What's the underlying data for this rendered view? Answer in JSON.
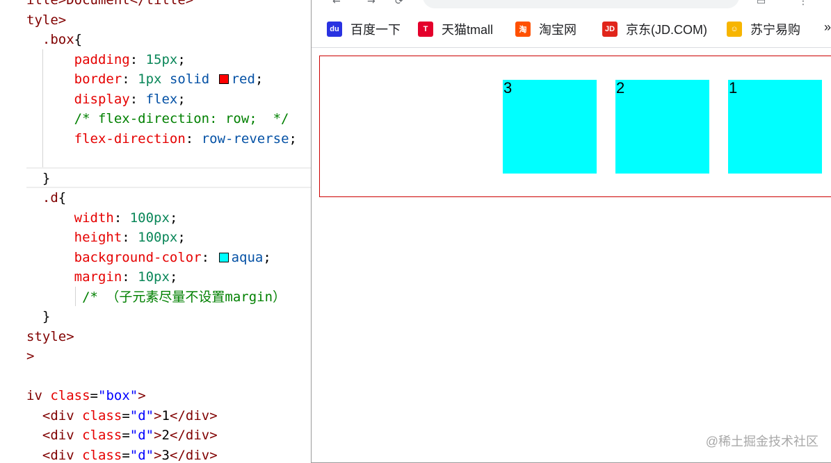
{
  "editor": {
    "lines": [
      {
        "segments": [
          {
            "t": "itle>Document</title>",
            "c": "tag"
          }
        ]
      },
      {
        "segments": [
          {
            "t": "tyle>",
            "c": "tag"
          }
        ]
      },
      {
        "segments": [
          {
            "t": "  ",
            "c": "txt"
          },
          {
            "t": ".box",
            "c": "sel"
          },
          {
            "t": "{",
            "c": "txt"
          }
        ]
      },
      {
        "segments": [
          {
            "t": "      ",
            "c": "txt"
          },
          {
            "t": "padding",
            "c": "prop"
          },
          {
            "t": ": ",
            "c": "txt"
          },
          {
            "t": "15px",
            "c": "num"
          },
          {
            "t": ";",
            "c": "txt"
          }
        ]
      },
      {
        "segments": [
          {
            "t": "      ",
            "c": "txt"
          },
          {
            "t": "border",
            "c": "prop"
          },
          {
            "t": ": ",
            "c": "txt"
          },
          {
            "t": "1px",
            "c": "num"
          },
          {
            "t": " ",
            "c": "txt"
          },
          {
            "t": "solid",
            "c": "val"
          },
          {
            "t": " ",
            "c": "txt"
          },
          {
            "swatch": "#ff0000"
          },
          {
            "t": "red",
            "c": "val"
          },
          {
            "t": ";",
            "c": "txt"
          }
        ]
      },
      {
        "segments": [
          {
            "t": "      ",
            "c": "txt"
          },
          {
            "t": "display",
            "c": "prop"
          },
          {
            "t": ": ",
            "c": "txt"
          },
          {
            "t": "flex",
            "c": "val"
          },
          {
            "t": ";",
            "c": "txt"
          }
        ]
      },
      {
        "segments": [
          {
            "t": "      ",
            "c": "txt"
          },
          {
            "t": "/* flex-direction: row;  */",
            "c": "cmt"
          }
        ]
      },
      {
        "segments": [
          {
            "t": "      ",
            "c": "txt"
          },
          {
            "t": "flex-direction",
            "c": "prop"
          },
          {
            "t": ": ",
            "c": "txt"
          },
          {
            "t": "row-reverse",
            "c": "val"
          },
          {
            "t": ";",
            "c": "txt"
          }
        ]
      },
      {
        "segments": [
          {
            "t": "",
            "c": "txt"
          }
        ]
      },
      {
        "segments": [
          {
            "t": "  }",
            "c": "txt"
          }
        ]
      },
      {
        "segments": [
          {
            "t": "  ",
            "c": "txt"
          },
          {
            "t": ".d",
            "c": "sel"
          },
          {
            "t": "{",
            "c": "txt"
          }
        ]
      },
      {
        "segments": [
          {
            "t": "      ",
            "c": "txt"
          },
          {
            "t": "width",
            "c": "prop"
          },
          {
            "t": ": ",
            "c": "txt"
          },
          {
            "t": "100px",
            "c": "num"
          },
          {
            "t": ";",
            "c": "txt"
          }
        ]
      },
      {
        "segments": [
          {
            "t": "      ",
            "c": "txt"
          },
          {
            "t": "height",
            "c": "prop"
          },
          {
            "t": ": ",
            "c": "txt"
          },
          {
            "t": "100px",
            "c": "num"
          },
          {
            "t": ";",
            "c": "txt"
          }
        ]
      },
      {
        "segments": [
          {
            "t": "      ",
            "c": "txt"
          },
          {
            "t": "background-color",
            "c": "prop"
          },
          {
            "t": ": ",
            "c": "txt"
          },
          {
            "swatch": "#00ffff"
          },
          {
            "t": "aqua",
            "c": "val"
          },
          {
            "t": ";",
            "c": "txt"
          }
        ]
      },
      {
        "segments": [
          {
            "t": "      ",
            "c": "txt"
          },
          {
            "t": "margin",
            "c": "prop"
          },
          {
            "t": ": ",
            "c": "txt"
          },
          {
            "t": "10px",
            "c": "num"
          },
          {
            "t": ";",
            "c": "txt"
          }
        ]
      },
      {
        "segments": [
          {
            "t": "       ",
            "c": "txt"
          },
          {
            "t": "/* （子元素尽量不设置margin）",
            "c": "cmt"
          }
        ]
      },
      {
        "segments": [
          {
            "t": "  }",
            "c": "txt"
          }
        ]
      },
      {
        "segments": [
          {
            "t": "style>",
            "c": "tag"
          }
        ]
      },
      {
        "segments": [
          {
            "t": ">",
            "c": "tag"
          }
        ]
      },
      {
        "segments": [
          {
            "t": "",
            "c": "txt"
          }
        ]
      },
      {
        "segments": [
          {
            "t": "iv",
            "c": "tag"
          },
          {
            "t": " ",
            "c": "txt"
          },
          {
            "t": "class",
            "c": "attr"
          },
          {
            "t": "=",
            "c": "txt"
          },
          {
            "t": "\"box\"",
            "c": "str"
          },
          {
            "t": ">",
            "c": "tag"
          }
        ]
      },
      {
        "segments": [
          {
            "t": "  ",
            "c": "txt"
          },
          {
            "t": "<div",
            "c": "tag"
          },
          {
            "t": " ",
            "c": "txt"
          },
          {
            "t": "class",
            "c": "attr"
          },
          {
            "t": "=",
            "c": "txt"
          },
          {
            "t": "\"d\"",
            "c": "str"
          },
          {
            "t": ">",
            "c": "tag"
          },
          {
            "t": "1",
            "c": "txt"
          },
          {
            "t": "</div>",
            "c": "tag"
          }
        ]
      },
      {
        "segments": [
          {
            "t": "  ",
            "c": "txt"
          },
          {
            "t": "<div",
            "c": "tag"
          },
          {
            "t": " ",
            "c": "txt"
          },
          {
            "t": "class",
            "c": "attr"
          },
          {
            "t": "=",
            "c": "txt"
          },
          {
            "t": "\"d\"",
            "c": "str"
          },
          {
            "t": ">",
            "c": "tag"
          },
          {
            "t": "2",
            "c": "txt"
          },
          {
            "t": "</div>",
            "c": "tag"
          }
        ]
      },
      {
        "segments": [
          {
            "t": "  ",
            "c": "txt"
          },
          {
            "t": "<div",
            "c": "tag"
          },
          {
            "t": " ",
            "c": "txt"
          },
          {
            "t": "class",
            "c": "attr"
          },
          {
            "t": "=",
            "c": "txt"
          },
          {
            "t": "\"d\"",
            "c": "str"
          },
          {
            "t": ">",
            "c": "tag"
          },
          {
            "t": "3",
            "c": "txt"
          },
          {
            "t": "</div>",
            "c": "tag"
          }
        ]
      }
    ]
  },
  "browser": {
    "bookmarks": [
      {
        "label": "百度一下",
        "icon": "baidu-icon",
        "glyph": "du",
        "color": "#2932e1"
      },
      {
        "label": "天猫tmall",
        "icon": "tmall-icon",
        "glyph": "T",
        "color": "#e4002b"
      },
      {
        "label": "淘宝网",
        "icon": "taobao-icon",
        "glyph": "淘",
        "color": "#ff5000"
      },
      {
        "label": "京东(JD.COM)",
        "icon": "jd-icon",
        "glyph": "JD",
        "color": "#e1251b"
      },
      {
        "label": "苏宁易购",
        "icon": "suning-icon",
        "glyph": "☺",
        "color": "#f7b500"
      }
    ],
    "overflow": "»",
    "page": {
      "box_border_color": "#cc0000",
      "item_color": "#00ffff",
      "items": [
        "3",
        "2",
        "1"
      ]
    }
  },
  "watermark": "@稀土掘金技术社区"
}
